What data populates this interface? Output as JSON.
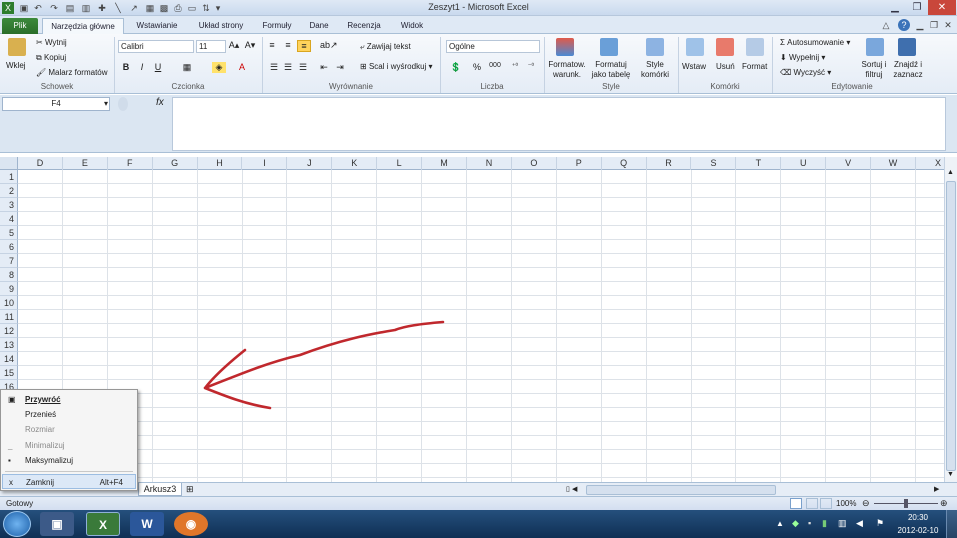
{
  "title": "Zeszyt1  -  Microsoft Excel",
  "tabs": [
    "Plik",
    "Narzędzia główne",
    "Wstawianie",
    "Układ strony",
    "Formuły",
    "Dane",
    "Recenzja",
    "Widok"
  ],
  "ribbon": {
    "clipboard": {
      "paste": "Wklej",
      "cut": "Wytnij",
      "copy": "Kopiuj",
      "painter": "Malarz formatów",
      "group": "Schowek"
    },
    "font": {
      "name": "Calibri",
      "size": "11",
      "bold": "B",
      "italic": "I",
      "underline": "U",
      "group": "Czcionka"
    },
    "alignment": {
      "wrap": "Zawijaj tekst",
      "merge": "Scal i wyśrodkuj",
      "group": "Wyrównanie"
    },
    "number": {
      "format": "Ogólne",
      "percent": "%",
      "thousands": "000",
      "group": "Liczba"
    },
    "styles": {
      "conditional": "Formatow. warunk.",
      "table": "Formatuj jako tabelę",
      "cell": "Style komórki",
      "group": "Style"
    },
    "cells": {
      "insert": "Wstaw",
      "delete": "Usuń",
      "format": "Format",
      "group": "Komórki"
    },
    "editing": {
      "autosum": "Autosumowanie",
      "fill": "Wypełnij",
      "clear": "Wyczyść",
      "sort": "Sortuj i filtruj",
      "find": "Znajdź i zaznacz",
      "group": "Edytowanie"
    }
  },
  "namebox": "F4",
  "fx": "fx",
  "columns": [
    "D",
    "E",
    "F",
    "G",
    "H",
    "I",
    "J",
    "K",
    "L",
    "M",
    "N",
    "O",
    "P",
    "Q",
    "R",
    "S",
    "T",
    "U",
    "V",
    "W",
    "X"
  ],
  "rows": [
    "1",
    "2",
    "3",
    "4",
    "5",
    "6",
    "7",
    "8",
    "9",
    "10",
    "11",
    "12",
    "13",
    "14",
    "15",
    "16"
  ],
  "sheet_tab": "Arkusz3",
  "status": {
    "ready": "Gotowy",
    "zoom": "100%"
  },
  "context_menu": [
    {
      "label": "Przywróć",
      "icon": "restore-icon",
      "enabled": true,
      "bold": true
    },
    {
      "label": "Przenieś",
      "enabled": true
    },
    {
      "label": "Rozmiar",
      "enabled": false
    },
    {
      "label": "Minimalizuj",
      "icon": "minimize-icon",
      "enabled": false
    },
    {
      "label": "Maksymalizuj",
      "icon": "maximize-icon",
      "enabled": true
    },
    {
      "label": "Zamknij",
      "icon": "close-icon",
      "shortcut": "Alt+F4",
      "enabled": true
    }
  ],
  "clock": {
    "time": "20:30",
    "date": "2012-02-10"
  },
  "annotation_color": "#c0282d"
}
